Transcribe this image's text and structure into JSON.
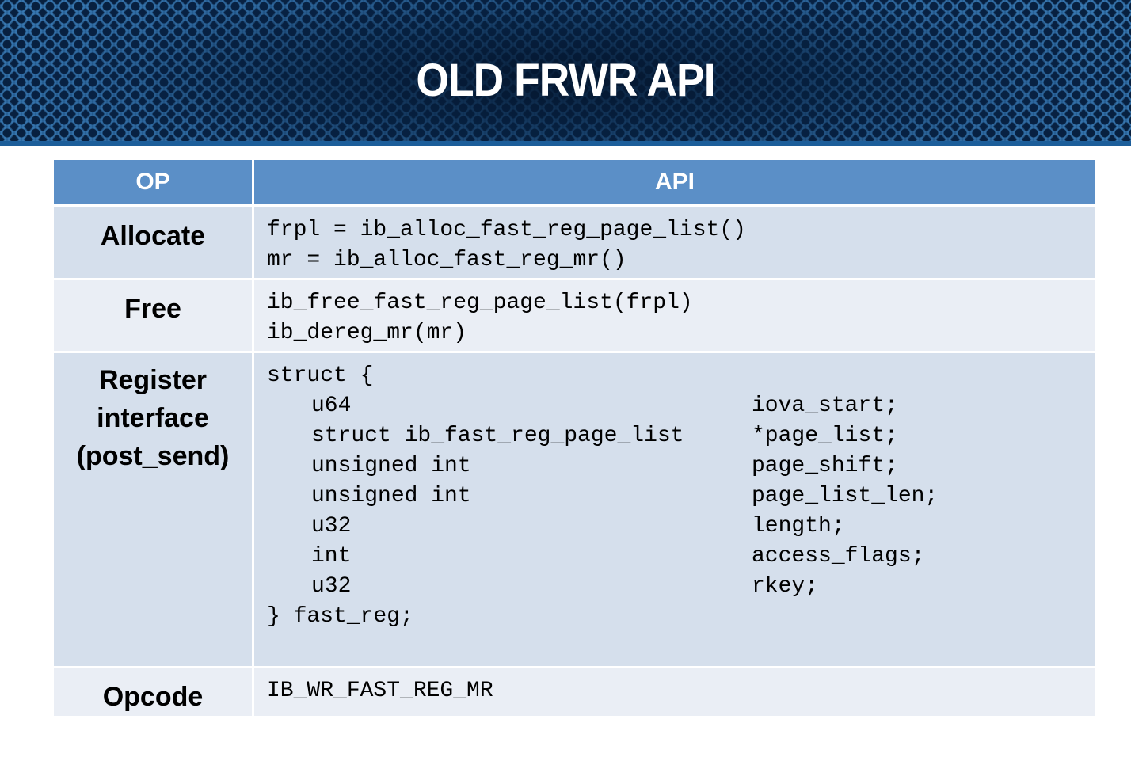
{
  "title": "OLD FRWR API",
  "colors": {
    "header_bg": "#5b8fc7",
    "row_dark": "#d5dfec",
    "row_light": "#eaeef5",
    "banner": "#0f3f6e"
  },
  "table": {
    "headers": {
      "op": "OP",
      "api": "API"
    },
    "allocate": {
      "op": "Allocate",
      "lines": [
        "frpl = ib_alloc_fast_reg_page_list()",
        "mr = ib_alloc_fast_reg_mr()"
      ]
    },
    "free": {
      "op": "Free",
      "lines": [
        "ib_free_fast_reg_page_list(frpl)",
        "ib_dereg_mr(mr)"
      ]
    },
    "register": {
      "op_lines": [
        "Register",
        "interface",
        "(post_send)"
      ],
      "open": "struct {",
      "fields": [
        {
          "type": "u64",
          "name": "iova_start;"
        },
        {
          "type": "struct ib_fast_reg_page_list",
          "name": "*page_list;"
        },
        {
          "type": "unsigned int",
          "name": "page_shift;"
        },
        {
          "type": "unsigned int",
          "name": "page_list_len;"
        },
        {
          "type": "u32",
          "name": "length;"
        },
        {
          "type": "int",
          "name": "access_flags;"
        },
        {
          "type": "u32",
          "name": "rkey;"
        }
      ],
      "close": "} fast_reg;"
    },
    "opcode": {
      "op": "Opcode",
      "value": "IB_WR_FAST_REG_MR"
    }
  }
}
